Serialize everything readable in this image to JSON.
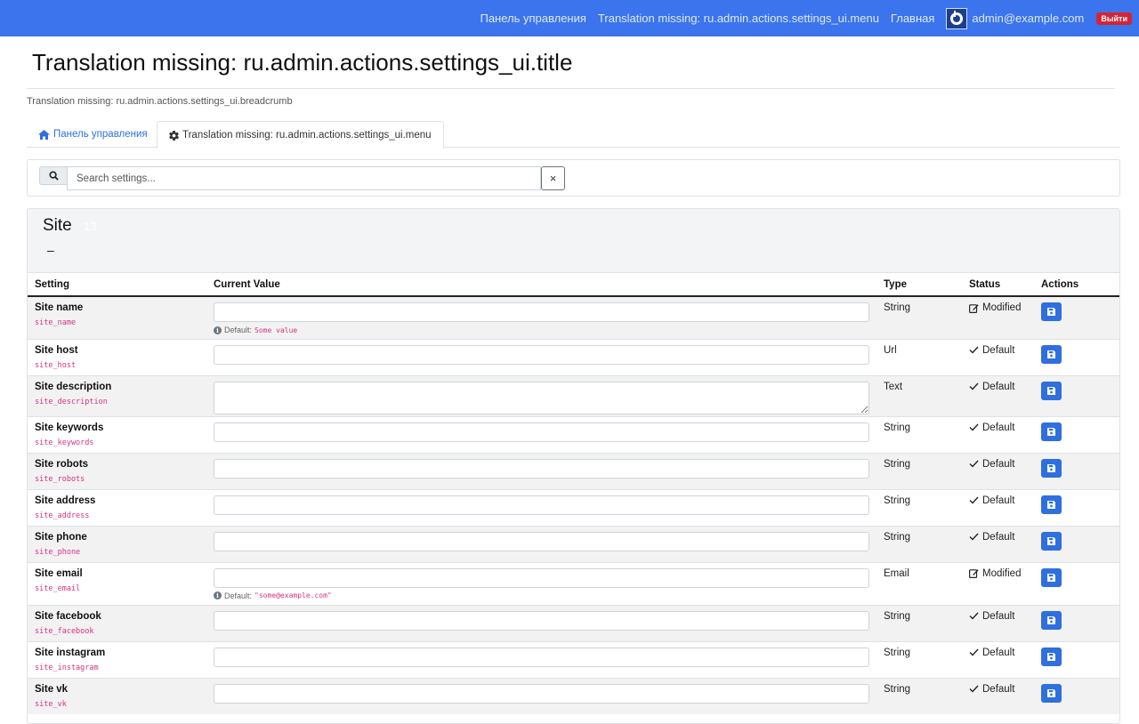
{
  "navbar": {
    "links": [
      "Панель управления",
      "Translation missing: ru.admin.actions.settings_ui.menu",
      "Главная"
    ],
    "user_email": "admin@example.com",
    "logout_label": "Выйти",
    "brand_color": "#3b74ec"
  },
  "page": {
    "title": "Translation missing: ru.admin.actions.settings_ui.title",
    "breadcrumb": "Translation missing: ru.admin.actions.settings_ui.breadcrumb"
  },
  "tabs": [
    {
      "label": "Панель управления",
      "icon": "home-icon"
    },
    {
      "label": "Translation missing: ru.admin.actions.settings_ui.menu",
      "icon": "gear-icon"
    }
  ],
  "search": {
    "placeholder": "Search settings...",
    "value": "",
    "clear_label": "×"
  },
  "section": {
    "title": "Site",
    "count": "13",
    "collapse_label": "–"
  },
  "table": {
    "headers": [
      "Setting",
      "Current Value",
      "Type",
      "Status",
      "Actions"
    ],
    "rows": [
      {
        "name": "Site name",
        "key": "site_name",
        "type": "String",
        "status": "Modified",
        "default_label": "Default:",
        "default_value": "Some value"
      },
      {
        "name": "Site host",
        "key": "site_host",
        "type": "Url",
        "status": "Default"
      },
      {
        "name": "Site description",
        "key": "site_description",
        "type": "Text",
        "status": "Default"
      },
      {
        "name": "Site keywords",
        "key": "site_keywords",
        "type": "String",
        "status": "Default"
      },
      {
        "name": "Site robots",
        "key": "site_robots",
        "type": "String",
        "status": "Default"
      },
      {
        "name": "Site address",
        "key": "site_address",
        "type": "String",
        "status": "Default"
      },
      {
        "name": "Site phone",
        "key": "site_phone",
        "type": "String",
        "status": "Default"
      },
      {
        "name": "Site email",
        "key": "site_email",
        "type": "Email",
        "status": "Modified",
        "default_label": "Default:",
        "default_value": "\"some@example.com\""
      },
      {
        "name": "Site facebook",
        "key": "site_facebook",
        "type": "String",
        "status": "Default"
      },
      {
        "name": "Site instagram",
        "key": "site_instagram",
        "type": "String",
        "status": "Default"
      },
      {
        "name": "Site vk",
        "key": "site_vk",
        "type": "String",
        "status": "Default"
      }
    ]
  }
}
